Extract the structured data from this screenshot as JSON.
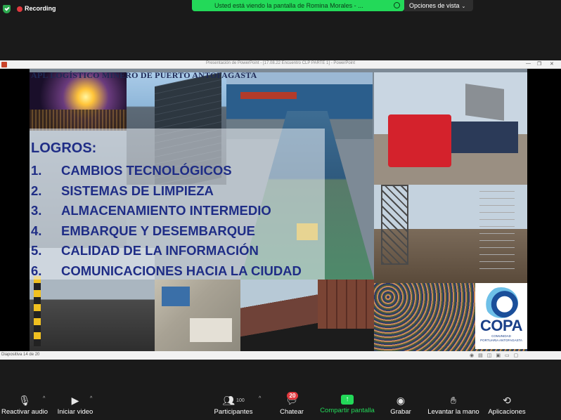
{
  "topbar": {
    "recording_label": "Recording",
    "share_banner": "Usted está viendo la pantalla de Romina Morales - ...",
    "view_options_label": "Opciones de vista",
    "brand_green": "#23d959",
    "record_red": "#e0393e"
  },
  "ppt": {
    "window_title": "Presentación de PowerPoint - [17.08.22 Encuentro CLP PARTE 1] - PowerPoint",
    "status_slide_counter": "Diapositiva 14 de 20"
  },
  "slide": {
    "title": "APL LOGÍSTICO MINERO DE PUERTO ANTOFAGASTA",
    "heading": "LOGROS:",
    "achievements": [
      {
        "num": "1.",
        "text": "CAMBIOS TECNOLÓGICOS"
      },
      {
        "num": "2.",
        "text": "SISTEMAS DE LIMPIEZA"
      },
      {
        "num": "3.",
        "text": "ALMACENAMIENTO INTERMEDIO"
      },
      {
        "num": "4.",
        "text": "EMBARQUE Y DESEMBARQUE"
      },
      {
        "num": "5.",
        "text": "CALIDAD DE LA INFORMACIÓN"
      },
      {
        "num": "6.",
        "text": "COMUNICACIONES HACIA LA CIUDAD"
      }
    ],
    "logo": {
      "word": "COPA",
      "subtitle_1": "COMUNIDAD",
      "subtitle_2": "PORTUARIA ANTOFAGASTA"
    }
  },
  "toolbar": {
    "mute": {
      "label": "Reactivar audio",
      "icon": "mic-off-icon"
    },
    "video": {
      "label": "Iniciar video",
      "icon": "video-off-icon"
    },
    "participants": {
      "label": "Participantes",
      "count": "100",
      "icon": "participants-icon"
    },
    "chat": {
      "label": "Chatear",
      "badge": "20",
      "icon": "chat-icon"
    },
    "share": {
      "label": "Compartir pantalla",
      "icon": "share-screen-icon"
    },
    "record": {
      "label": "Grabar",
      "icon": "record-icon"
    },
    "raise_hand": {
      "label": "Levantar la mano",
      "icon": "hand-icon"
    },
    "apps": {
      "label": "Aplicaciones",
      "icon": "apps-icon"
    }
  }
}
